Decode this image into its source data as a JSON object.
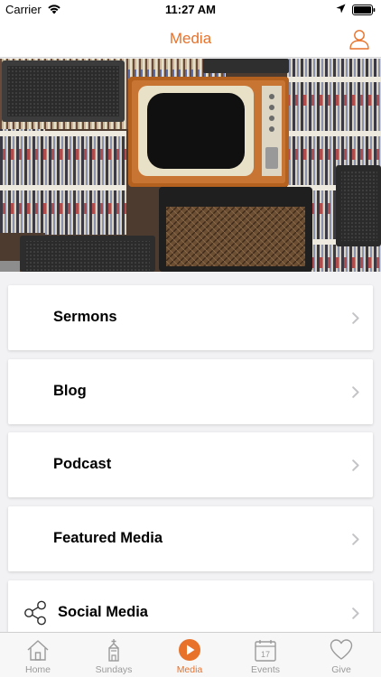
{
  "status_bar": {
    "carrier": "Carrier",
    "time": "11:27 AM"
  },
  "nav": {
    "title": "Media",
    "profile_icon": "person-icon"
  },
  "hero": {
    "description_icon": "media-collage-image"
  },
  "menu": [
    {
      "label": "Sermons",
      "icon": ""
    },
    {
      "label": "Blog",
      "icon": ""
    },
    {
      "label": "Podcast",
      "icon": ""
    },
    {
      "label": "Featured Media",
      "icon": ""
    },
    {
      "label": "Social Media",
      "icon": "share-icon"
    }
  ],
  "tabs": [
    {
      "label": "Home",
      "icon": "house-icon",
      "active": false
    },
    {
      "label": "Sundays",
      "icon": "church-icon",
      "active": false
    },
    {
      "label": "Media",
      "icon": "play-circle-icon",
      "active": true
    },
    {
      "label": "Events",
      "icon": "calendar-icon",
      "active": false
    },
    {
      "label": "Give",
      "icon": "heart-icon",
      "active": false
    }
  ],
  "calendar_day": "17",
  "colors": {
    "accent": "#e8722a",
    "inactive": "#9a9a9a",
    "background": "#f2f2f4"
  }
}
